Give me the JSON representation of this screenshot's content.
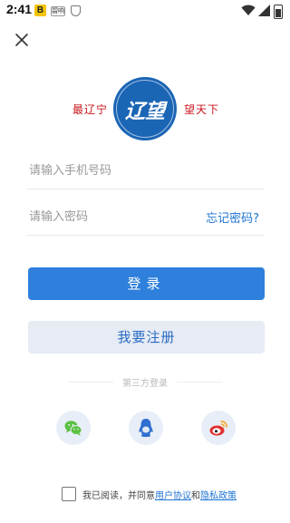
{
  "status_bar": {
    "time": "2:41",
    "badge_letter": "B",
    "app_label": "碧响"
  },
  "logo": {
    "slogan_left": "最辽宁",
    "slogan_right": "望天下",
    "emblem_text": "辽望",
    "brand_color": "#1b65b5",
    "slogan_color": "#c8161d"
  },
  "form": {
    "phone_placeholder": "请输入手机号码",
    "phone_value": "",
    "password_placeholder": "请输入密码",
    "password_value": "",
    "forgot_password": "忘记密码?"
  },
  "buttons": {
    "login": "登录",
    "register": "我要注册",
    "login_color": "#2e80dc",
    "register_bg": "#e6ebf4"
  },
  "third_party": {
    "label": "第三方登录",
    "providers": [
      {
        "name": "wechat",
        "icon": "wechat-icon"
      },
      {
        "name": "qq",
        "icon": "qq-icon"
      },
      {
        "name": "weibo",
        "icon": "weibo-icon"
      }
    ]
  },
  "agreement": {
    "prefix": "我已阅读，并同意",
    "user_agreement": "用户协议",
    "conjunction": "和",
    "privacy_policy": "隐私政策",
    "checked": false
  }
}
